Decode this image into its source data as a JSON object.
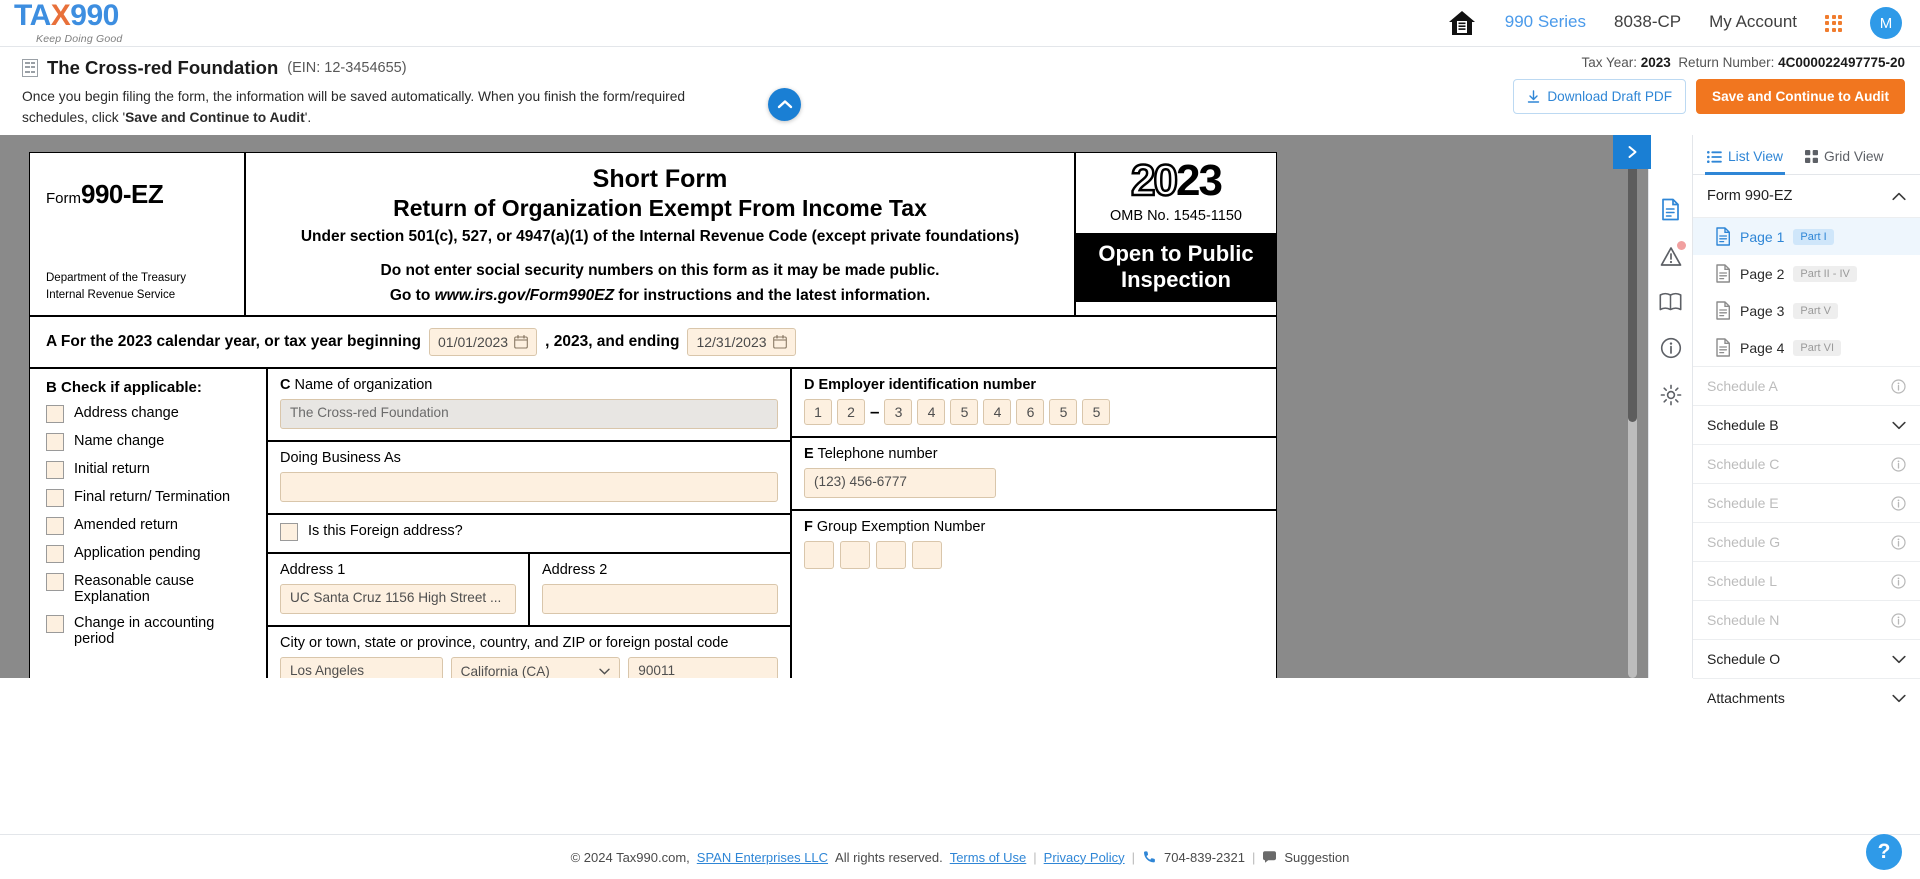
{
  "brand": {
    "name_part1": "TA",
    "name_x": "X",
    "name_part2": "990",
    "tagline": "Keep Doing Good"
  },
  "topnav": {
    "home_icon": "home-icon",
    "links": [
      {
        "label": "990 Series",
        "active": true
      },
      {
        "label": "8038-CP",
        "active": false
      },
      {
        "label": "My Account",
        "active": false
      }
    ],
    "apps_icon": "grid-apps-icon",
    "avatar_initial": "M"
  },
  "subheader": {
    "org_name": "The Cross-red Foundation",
    "org_ein": "(EIN: 12-3454655)",
    "note_part1": "Once you begin filing the form, the information will be saved automatically. When you finish the form/required schedules, click '",
    "note_bold": "Save and Continue to Audit",
    "note_part2": "'.",
    "tax_year_label": "Tax Year:",
    "tax_year_value": "2023",
    "return_number_label": "Return Number:",
    "return_number_value": "4C000022497775-20",
    "download_label": "Download Draft PDF",
    "save_label": "Save and Continue to Audit",
    "collapse_icon": "chevron-up-icon"
  },
  "form": {
    "form_label": "Form",
    "form_number": "990-EZ",
    "dept_line1": "Department of the Treasury",
    "dept_line2": "Internal Revenue Service",
    "title1": "Short Form",
    "title2": "Return of Organization Exempt From Income Tax",
    "subtitle": "Under section 501(c), 527, or 4947(a)(1) of the Internal Revenue Code (except private foundations)",
    "warning": "Do not enter social security numbers on this form as it may be made public.",
    "goto_pre": "Go to ",
    "goto_url": "www.irs.gov/Form990EZ",
    "goto_post": " for instructions and the latest information.",
    "year_hollow": "20",
    "year_solid": "23",
    "omb": "OMB No. 1545-1150",
    "open_public": "Open to Public Inspection",
    "rowA_pre": "A For the 2023 calendar year, or tax year beginning",
    "rowA_begin_value": "01/01/2023",
    "rowA_mid": ", 2023, and ending",
    "rowA_end_value": "12/31/2023",
    "sectionB_label": "B",
    "sectionB_title": "Check if applicable:",
    "checkboxes": [
      "Address change",
      "Name change",
      "Initial return",
      "Final return/ Termination",
      "Amended return",
      "Application pending",
      "Reasonable cause Explanation",
      "Change in accounting period"
    ],
    "sectionC_label": "C",
    "sectionC_title": "Name of organization",
    "org_name_value": "The Cross-red Foundation",
    "dba_label": "Doing Business As",
    "dba_value": "",
    "foreign_label": "Is this Foreign address?",
    "address1_label": "Address 1",
    "address1_value": "UC Santa Cruz 1156 High Street ...",
    "address2_label": "Address 2",
    "address2_value": "",
    "city_label": "City or town, state or province, country, and ZIP or foreign postal code",
    "city_value": "Los Angeles",
    "state_value": "California (CA)",
    "zip_value": "90011",
    "sectionD_label": "D",
    "sectionD_title": "Employer identification number",
    "ein_digits": [
      "1",
      "2",
      "3",
      "4",
      "5",
      "4",
      "6",
      "5",
      "5"
    ],
    "sectionE_label": "E",
    "sectionE_title": "Telephone number",
    "phone_value": "(123) 456-6777",
    "sectionF_label": "F",
    "sectionF_title": "Group Exemption Number",
    "group_digits": [
      "",
      "",
      "",
      ""
    ]
  },
  "rail": {
    "expand_icon": "chevron-right-icon",
    "icons": [
      "document-icon",
      "warning-triangle-icon",
      "book-icon",
      "info-circle-icon",
      "gear-icon"
    ]
  },
  "sidebar": {
    "tabs": [
      {
        "label": "List View",
        "icon": "list-icon",
        "active": true
      },
      {
        "label": "Grid View",
        "icon": "grid-icon",
        "active": false
      }
    ],
    "form_group": {
      "label": "Form 990-EZ",
      "icon": "chevron-up-icon"
    },
    "pages": [
      {
        "label": "Page 1",
        "badge": "Part I",
        "active": true
      },
      {
        "label": "Page 2",
        "badge": "Part II - IV",
        "active": false
      },
      {
        "label": "Page 3",
        "badge": "Part V",
        "active": false
      },
      {
        "label": "Page 4",
        "badge": "Part VI",
        "active": false
      }
    ],
    "schedules": [
      {
        "label": "Schedule A",
        "icon": "info-circle-icon",
        "state": "dim"
      },
      {
        "label": "Schedule B",
        "icon": "chevron-down-icon",
        "state": "on"
      },
      {
        "label": "Schedule C",
        "icon": "info-circle-icon",
        "state": "dim"
      },
      {
        "label": "Schedule E",
        "icon": "info-circle-icon",
        "state": "dim"
      },
      {
        "label": "Schedule G",
        "icon": "info-circle-icon",
        "state": "dim"
      },
      {
        "label": "Schedule L",
        "icon": "info-circle-icon",
        "state": "dim"
      },
      {
        "label": "Schedule N",
        "icon": "info-circle-icon",
        "state": "dim"
      },
      {
        "label": "Schedule O",
        "icon": "chevron-down-icon",
        "state": "on"
      },
      {
        "label": "Attachments",
        "icon": "chevron-down-icon",
        "state": "on"
      }
    ]
  },
  "footer": {
    "copyright": "© 2024 Tax990.com,",
    "company": "SPAN Enterprises LLC",
    "rights": "All rights reserved.",
    "terms": "Terms of Use",
    "privacy": "Privacy Policy",
    "phone": "704-839-2321",
    "suggestion": "Suggestion",
    "help_label": "?"
  },
  "colors": {
    "accent": "#2f86d6",
    "orange": "#f1761f",
    "field": "#fdf0e0"
  }
}
